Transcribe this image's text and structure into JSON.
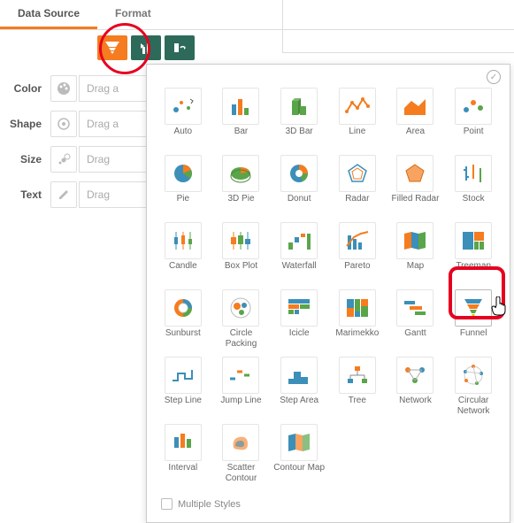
{
  "tabs": {
    "dataSource": "Data Source",
    "format": "Format"
  },
  "props": {
    "color": {
      "label": "Color",
      "placeholder": "Drag a"
    },
    "shape": {
      "label": "Shape",
      "placeholder": "Drag a"
    },
    "size": {
      "label": "Size",
      "placeholder": "Drag"
    },
    "text": {
      "label": "Text",
      "placeholder": "Drag"
    }
  },
  "chartTypes": {
    "auto": "Auto",
    "bar": "Bar",
    "bar3d": "3D Bar",
    "line": "Line",
    "area": "Area",
    "point": "Point",
    "pie": "Pie",
    "pie3d": "3D Pie",
    "donut": "Donut",
    "radar": "Radar",
    "filledRadar": "Filled Radar",
    "stock": "Stock",
    "candle": "Candle",
    "boxplot": "Box Plot",
    "waterfall": "Waterfall",
    "pareto": "Pareto",
    "map": "Map",
    "treemap": "Treemap",
    "sunburst": "Sunburst",
    "circlePacking": "Circle Packing",
    "icicle": "Icicle",
    "marimekko": "Marimekko",
    "gantt": "Gantt",
    "funnel": "Funnel",
    "stepLine": "Step Line",
    "jumpLine": "Jump Line",
    "stepArea": "Step Area",
    "tree": "Tree",
    "network": "Network",
    "circularNetwork": "Circular Network",
    "interval": "Interval",
    "scatterContour": "Scatter Contour",
    "contourMap": "Contour Map"
  },
  "popup": {
    "multipleStyles": "Multiple Styles"
  },
  "icons": {
    "funnelTool": "funnel-tool-icon",
    "barsTool": "bars-tool-icon",
    "rotateTool": "rotate-tool-icon",
    "palette": "palette-icon",
    "shape": "shape-icon",
    "size": "size-icon",
    "pencil": "pencil-icon"
  }
}
